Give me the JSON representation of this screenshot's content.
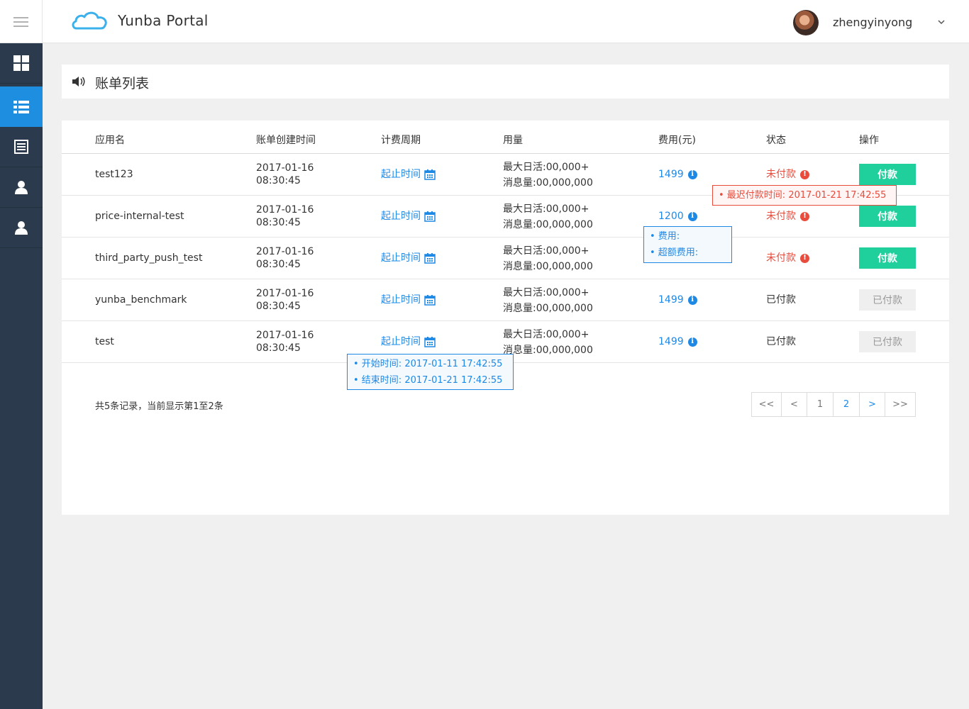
{
  "header": {
    "brand": "Yunba Portal",
    "username": "zhengyinyong"
  },
  "sidebar": {
    "items": [
      {
        "icon": "dashboard-icon",
        "active": false
      },
      {
        "icon": "list-icon",
        "active": true
      },
      {
        "icon": "table-icon",
        "active": false
      },
      {
        "icon": "user-icon",
        "active": false
      },
      {
        "icon": "user-icon",
        "active": false
      }
    ]
  },
  "page": {
    "title": "账单列表"
  },
  "table": {
    "columns": [
      "应用名",
      "账单创建时间",
      "计费周期",
      "用量",
      "费用(元)",
      "状态",
      "操作"
    ],
    "rows": [
      {
        "app": "test123",
        "date": "2017-01-16",
        "time": "08:30:45",
        "period": "起止时间",
        "usage_dau": "最大日活:00,000+",
        "usage_msg": "消息量:00,000,000",
        "fee": "1499",
        "status": "未付款",
        "action": "付款"
      },
      {
        "app": "price-internal-test",
        "date": "2017-01-16",
        "time": "08:30:45",
        "period": "起止时间",
        "usage_dau": "最大日活:00,000+",
        "usage_msg": "消息量:00,000,000",
        "fee": "1200",
        "status": "未付款",
        "action": "付款"
      },
      {
        "app": "third_party_push_test",
        "date": "2017-01-16",
        "time": "08:30:45",
        "period": "起止时间",
        "usage_dau": "最大日活:00,000+",
        "usage_msg": "消息量:00,000,000",
        "fee": "",
        "status": "未付款",
        "action": "付款"
      },
      {
        "app": "yunba_benchmark",
        "date": "2017-01-16",
        "time": "08:30:45",
        "period": "起止时间",
        "usage_dau": "最大日活:00,000+",
        "usage_msg": "消息量:00,000,000",
        "fee": "1499",
        "status": "已付款",
        "action": "已付款"
      },
      {
        "app": "test",
        "date": "2017-01-16",
        "time": "08:30:45",
        "period": "起止时间",
        "usage_dau": "最大日活:00,000+",
        "usage_msg": "消息量:00,000,000",
        "fee": "1499",
        "status": "已付款",
        "action": "已付款"
      }
    ]
  },
  "tooltips": {
    "deadline": "• 最迟付款时间: 2017-01-21 17:42:55",
    "fee_line1": "• 费用:",
    "fee_line2": "• 超额费用:",
    "period_start": "• 开始时间: 2017-01-11  17:42:55",
    "period_end": "• 结束时间: 2017-01-21  17:42:55"
  },
  "footer": {
    "summary": "共5条记录，当前显示第1至2条",
    "pager": [
      "<<",
      "<",
      "1",
      "2",
      ">",
      ">>"
    ]
  },
  "colors": {
    "accent": "#1e88e5",
    "sidebar": "#2b3b4d",
    "sidebar_active": "#1e8fe0",
    "pay_button": "#1fcf9c",
    "unpaid": "#e74c3c"
  }
}
